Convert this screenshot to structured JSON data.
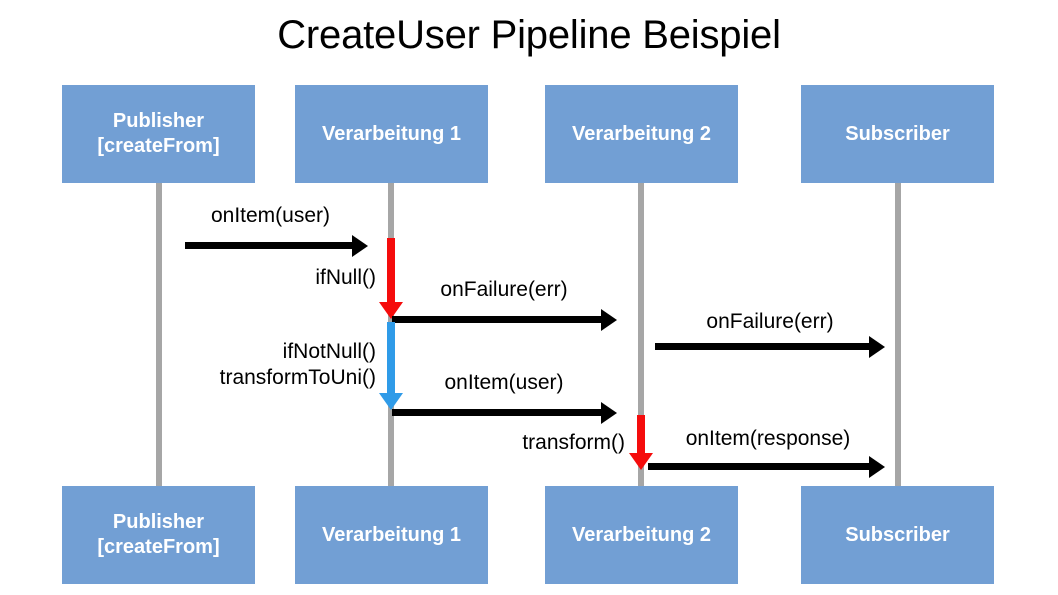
{
  "title": "CreateUser Pipeline Beispiel",
  "colors": {
    "participant_box": "#729fd4",
    "participant_text": "#ffffff",
    "lifeline": "#a6a6a6",
    "message_arrow": "#000000",
    "null_branch_arrow": "#f50c0c",
    "not_null_branch_arrow": "#2f9be8",
    "background": "#ffffff",
    "title_text": "#000000"
  },
  "participants": [
    {
      "id": "publisher",
      "label": "Publisher\n[createFrom]"
    },
    {
      "id": "verarbeitung1",
      "label": "Verarbeitung 1"
    },
    {
      "id": "verarbeitung2",
      "label": "Verarbeitung 2"
    },
    {
      "id": "subscriber",
      "label": "Subscriber"
    }
  ],
  "participants_bottom": [
    {
      "id": "publisher",
      "label": "Publisher\n[createFrom]"
    },
    {
      "id": "verarbeitung1",
      "label": "Verarbeitung 1"
    },
    {
      "id": "verarbeitung2",
      "label": "Verarbeitung 2"
    },
    {
      "id": "subscriber",
      "label": "Subscriber"
    }
  ],
  "messages": [
    {
      "id": "m1",
      "label": "onItem(user)",
      "from": "publisher",
      "to": "verarbeitung1",
      "color": "#000000"
    },
    {
      "id": "m2",
      "label": "onFailure(err)",
      "from": "verarbeitung1",
      "to": "verarbeitung2",
      "color": "#000000"
    },
    {
      "id": "m3",
      "label": "onFailure(err)",
      "from": "verarbeitung2",
      "to": "subscriber",
      "color": "#000000"
    },
    {
      "id": "m4",
      "label": "onItem(user)",
      "from": "verarbeitung1",
      "to": "verarbeitung2",
      "color": "#000000"
    },
    {
      "id": "m5",
      "label": "onItem(response)",
      "from": "verarbeitung2",
      "to": "subscriber",
      "color": "#000000"
    }
  ],
  "internal_steps": [
    {
      "id": "s1",
      "label": "ifNull()",
      "on": "verarbeitung1",
      "color": "#f50c0c"
    },
    {
      "id": "s2",
      "label": "ifNotNull()\ntransformToUni()",
      "on": "verarbeitung1",
      "color": "#2f9be8"
    },
    {
      "id": "s3",
      "label": "transform()",
      "on": "verarbeitung2",
      "color": "#f50c0c"
    }
  ]
}
